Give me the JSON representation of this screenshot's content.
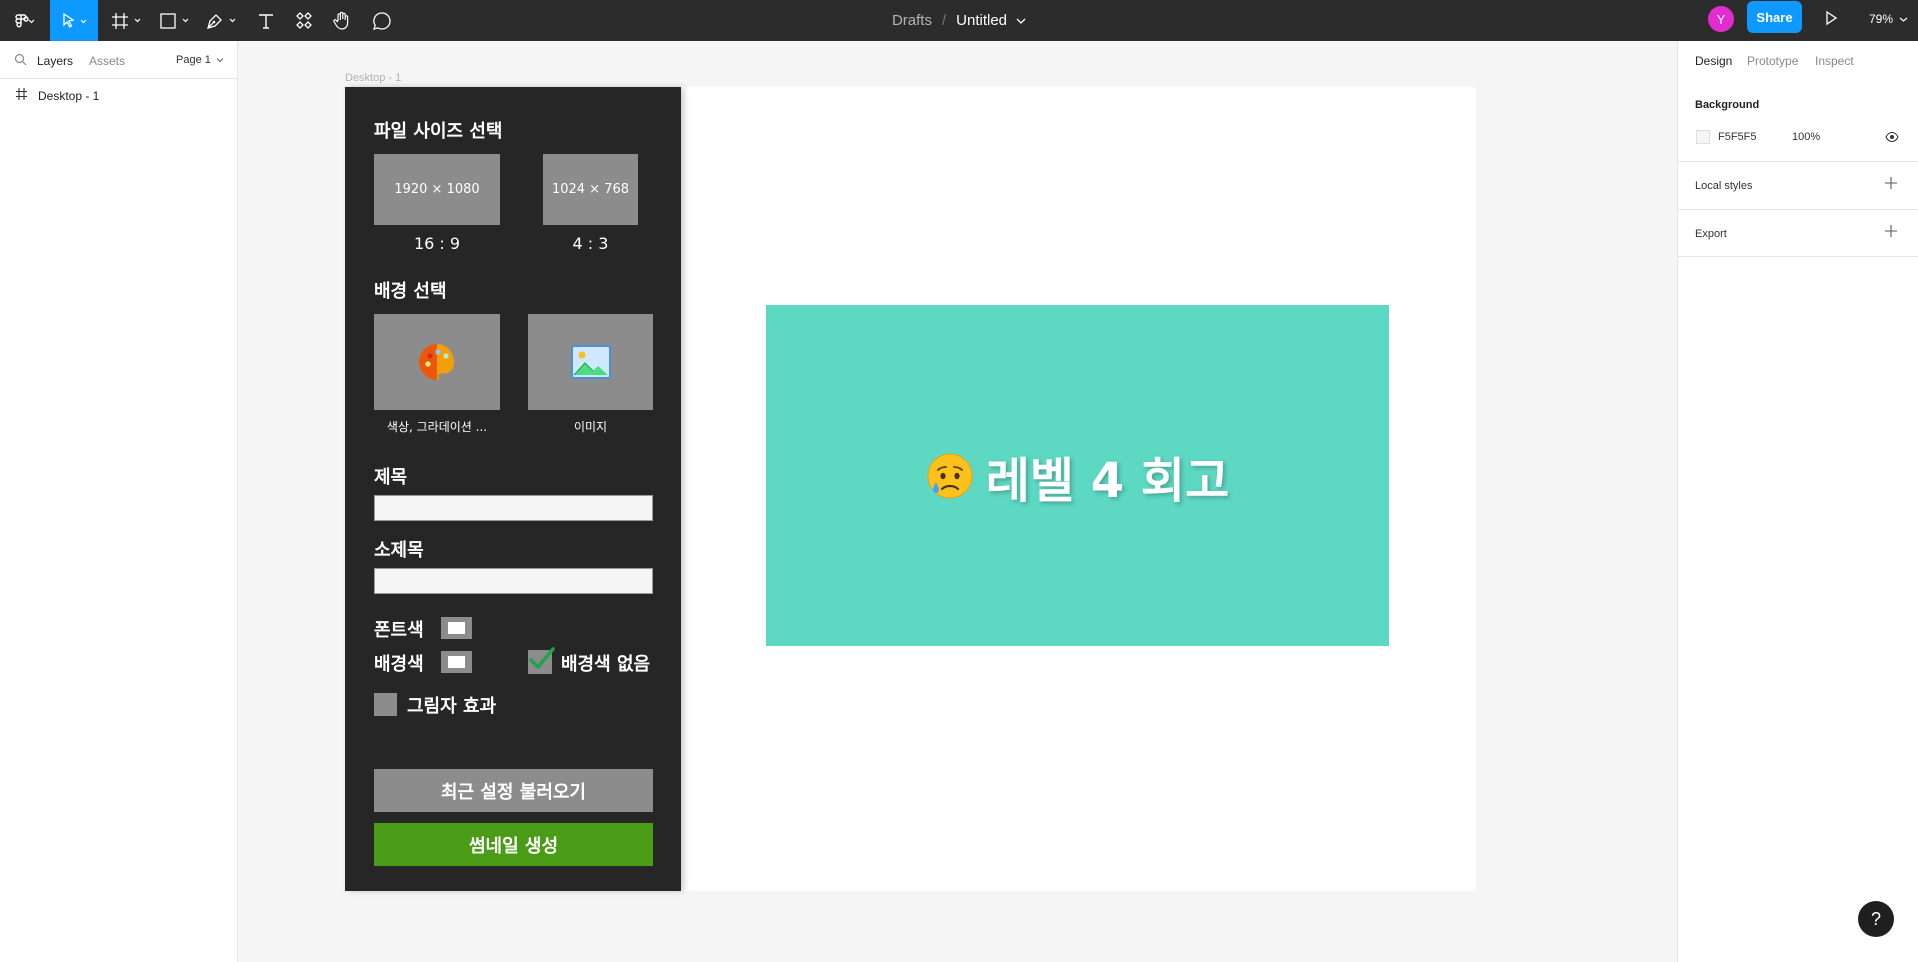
{
  "toolbar": {
    "breadcrumb_drafts": "Drafts",
    "breadcrumb_sep": "/",
    "file_title": "Untitled",
    "avatar_initial": "Y",
    "share_label": "Share",
    "zoom": "79%",
    "accent": "#0d99ff",
    "icons": [
      "figma-menu-icon",
      "move-tool-icon",
      "frame-tool-icon",
      "shape-tool-icon",
      "pen-tool-icon",
      "text-tool-icon",
      "components-icon",
      "hand-tool-icon",
      "comment-icon"
    ]
  },
  "left_panel": {
    "tab_layers": "Layers",
    "tab_assets": "Assets",
    "page": "Page 1",
    "layers": [
      {
        "name": "Desktop - 1"
      }
    ]
  },
  "right_panel": {
    "tab_design": "Design",
    "tab_prototype": "Prototype",
    "tab_inspect": "Inspect",
    "background_title": "Background",
    "bg_hex": "F5F5F5",
    "bg_opacity": "100%",
    "local_styles": "Local styles",
    "export": "Export"
  },
  "canvas": {
    "frame_label": "Desktop - 1",
    "plugin": {
      "size_heading": "파일 사이즈 선택",
      "size_options": [
        {
          "dims": "1920 × 1080",
          "ratio": "16 : 9"
        },
        {
          "dims": "1024 × 768",
          "ratio": "4 : 3"
        }
      ],
      "bg_heading": "배경 선택",
      "bg_options": [
        {
          "label": "색상, 그라데이션 ...",
          "icon": "palette-icon"
        },
        {
          "label": "이미지",
          "icon": "image-icon"
        }
      ],
      "title_label": "제목",
      "subtitle_label": "소제목",
      "font_color_label": "폰트색",
      "bg_color_label": "배경색",
      "no_bg_label": "배경색 없음",
      "no_bg_checked": true,
      "shadow_label": "그림자 효과",
      "shadow_checked": false,
      "load_button": "최근 설정 불러오기",
      "generate_button": "썸네일 생성",
      "generate_color": "#4a9c16"
    },
    "thumbnail": {
      "emoji": "😥",
      "title": "레벨 4 회고",
      "bg_color": "#5dd8c3"
    }
  },
  "help_label": "?"
}
